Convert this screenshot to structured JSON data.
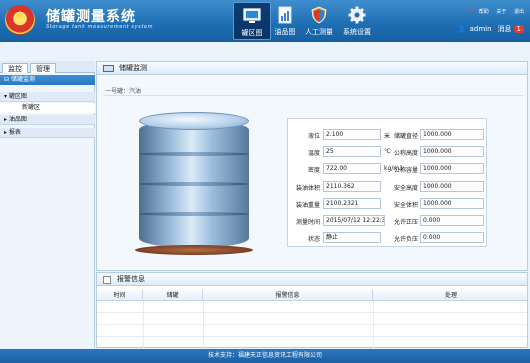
{
  "header": {
    "title": "储罐测量系统",
    "subtitle": "Storage tank measurement system",
    "nav": [
      {
        "label": "罐区图",
        "icon": "monitor-icon",
        "active": true
      },
      {
        "label": "油品图",
        "icon": "document-icon",
        "active": false
      },
      {
        "label": "人工测量",
        "icon": "shield-icon",
        "active": false
      },
      {
        "label": "系统设置",
        "icon": "gear-icon",
        "active": false
      }
    ],
    "top_links": {
      "help": "帮助",
      "about": "关于",
      "exit": "退出"
    },
    "user": {
      "name": "admin",
      "messages_label": "消息",
      "message_count": "1"
    }
  },
  "sidebar": {
    "tabs": [
      "监控",
      "管理"
    ],
    "active_tab": 0,
    "tree": {
      "header": "储罐监测",
      "groups": [
        {
          "label": "罐区图",
          "expanded": true,
          "children": [
            "新罐区"
          ]
        },
        {
          "label": "油品图",
          "expanded": false,
          "children": []
        },
        {
          "label": "报表",
          "expanded": false,
          "children": []
        }
      ]
    }
  },
  "main": {
    "title": "储罐监测",
    "tank_name": "一号罐：汽油",
    "level_fraction": 0.36,
    "left_fields": [
      {
        "label": "液位",
        "value": "2.100",
        "unit": "米"
      },
      {
        "label": "温度",
        "value": "25",
        "unit": "℃"
      },
      {
        "label": "密度",
        "value": "722.00",
        "unit": "kg/m3"
      },
      {
        "label": "装油体积",
        "value": "2110.362",
        "unit": ""
      },
      {
        "label": "装油重量",
        "value": "2100.2321",
        "unit": ""
      },
      {
        "label": "测量时间",
        "value": "2015/07/12 12:22:32",
        "unit": ""
      },
      {
        "label": "状态",
        "value": "静止",
        "unit": ""
      }
    ],
    "right_fields": [
      {
        "label": "储罐直径",
        "value": "1000.000"
      },
      {
        "label": "公称高度",
        "value": "1000.000"
      },
      {
        "label": "公称容量",
        "value": "1000.000"
      },
      {
        "label": "安全高度",
        "value": "1000.000"
      },
      {
        "label": "安全体积",
        "value": "1000.000"
      },
      {
        "label": "允许正压",
        "value": "0.000"
      },
      {
        "label": "允许负压",
        "value": "0.000"
      }
    ]
  },
  "alarm": {
    "title": "报警信息",
    "columns": [
      "时间",
      "储罐",
      "报警信息",
      "处理"
    ],
    "rows": []
  },
  "footer": {
    "text": "技术支持：福建天正信息资讯工程有限公司"
  }
}
